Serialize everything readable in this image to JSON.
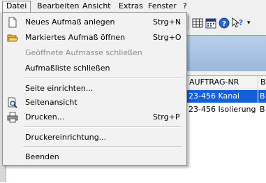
{
  "menubar": {
    "items": [
      {
        "label": "Datei"
      },
      {
        "label": "Bearbeiten"
      },
      {
        "label": "Ansicht"
      },
      {
        "label": "Extras"
      },
      {
        "label": "Fenster"
      },
      {
        "label": "?"
      }
    ]
  },
  "toolbar": {
    "buttons": [
      "grid-icon",
      "calendar-icon",
      "help-icon",
      "context-help-icon"
    ],
    "overflow_glyph": "▾"
  },
  "grid": {
    "columns": [
      "AUFTRAG-NR",
      "BA"
    ],
    "rows": [
      {
        "auftrag": "23-456 Kanal",
        "ba": "B",
        "selected": true
      },
      {
        "auftrag": "23-456 Isolierung",
        "ba": "B",
        "selected": false
      }
    ]
  },
  "file_menu": {
    "items": [
      {
        "label": "Neues Aufmaß anlegen",
        "shortcut": "Strg+N",
        "icon": "new-document-icon",
        "enabled": true
      },
      {
        "label": "Markiertes Aufmaß öffnen",
        "shortcut": "Strg+O",
        "icon": "open-folder-icon",
        "enabled": true
      },
      {
        "label": "Geöffnete Aufmasse schließen",
        "shortcut": "",
        "icon": "",
        "enabled": false
      },
      {
        "label": "Aufmaßliste schließen",
        "shortcut": "",
        "icon": "",
        "enabled": true
      },
      {
        "label": "Seite einrichten...",
        "shortcut": "",
        "icon": "",
        "enabled": true
      },
      {
        "label": "Seitenansicht",
        "shortcut": "",
        "icon": "print-preview-icon",
        "enabled": true
      },
      {
        "label": "Drucken...",
        "shortcut": "Strg+P",
        "icon": "printer-icon",
        "enabled": true
      },
      {
        "label": "Druckereinrichtung...",
        "shortcut": "",
        "icon": "",
        "enabled": true
      },
      {
        "label": "Beenden",
        "shortcut": "",
        "icon": "",
        "enabled": true
      }
    ]
  },
  "colors": {
    "selection": "#1560d8",
    "menu_background": "#f2f2f2",
    "disabled_text": "#8d8d8d",
    "blue_band": "#a9c4e4"
  }
}
